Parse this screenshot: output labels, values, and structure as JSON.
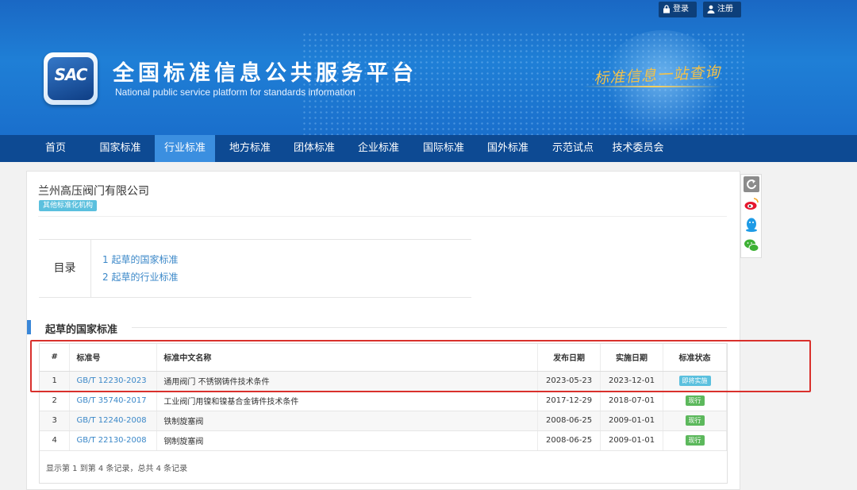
{
  "top_bar": {
    "login": "登录",
    "register": "注册"
  },
  "brand": {
    "logo_text": "SAC",
    "title_cn": "全国标准信息公共服务平台",
    "title_en": "National public service platform  for standards information",
    "slogan": "标准信息一站查询"
  },
  "nav": [
    "首页",
    "国家标准",
    "行业标准",
    "地方标准",
    "团体标准",
    "企业标准",
    "国际标准",
    "国外标准",
    "示范试点",
    "技术委员会"
  ],
  "nav_active_index": 2,
  "org": {
    "name": "兰州高压阀门有限公司",
    "tag": "其他标准化机构"
  },
  "toc": {
    "label": "目录",
    "items": [
      "1  起草的国家标准",
      "2  起草的行业标准"
    ]
  },
  "section": {
    "title": "起草的国家标准"
  },
  "table": {
    "headers": [
      "#",
      "标准号",
      "标准中文名称",
      "发布日期",
      "实施日期",
      "标准状态"
    ],
    "rows": [
      {
        "index": "1",
        "code": "GB/T 12230-2023",
        "name": "通用阀门 不锈钢铸件技术条件",
        "publish": "2023-05-23",
        "implement": "2023-12-01",
        "status": "即将实施",
        "status_type": "soon"
      },
      {
        "index": "2",
        "code": "GB/T 35740-2017",
        "name": "工业阀门用镍和镍基合金铸件技术条件",
        "publish": "2017-12-29",
        "implement": "2018-07-01",
        "status": "现行",
        "status_type": "now"
      },
      {
        "index": "3",
        "code": "GB/T 12240-2008",
        "name": "铁制旋塞阀",
        "publish": "2008-06-25",
        "implement": "2009-01-01",
        "status": "现行",
        "status_type": "now"
      },
      {
        "index": "4",
        "code": "GB/T 22130-2008",
        "name": "钢制旋塞阀",
        "publish": "2008-06-25",
        "implement": "2009-01-01",
        "status": "现行",
        "status_type": "now"
      }
    ],
    "footer": "显示第 1 到第 4 条记录，总共 4 条记录"
  },
  "colors": {
    "header_blue": "#1f7fd6",
    "nav_blue": "#0d4a93",
    "nav_active": "#3b8fe0",
    "link": "#3a87c8",
    "highlight_box": "#d9302c"
  }
}
